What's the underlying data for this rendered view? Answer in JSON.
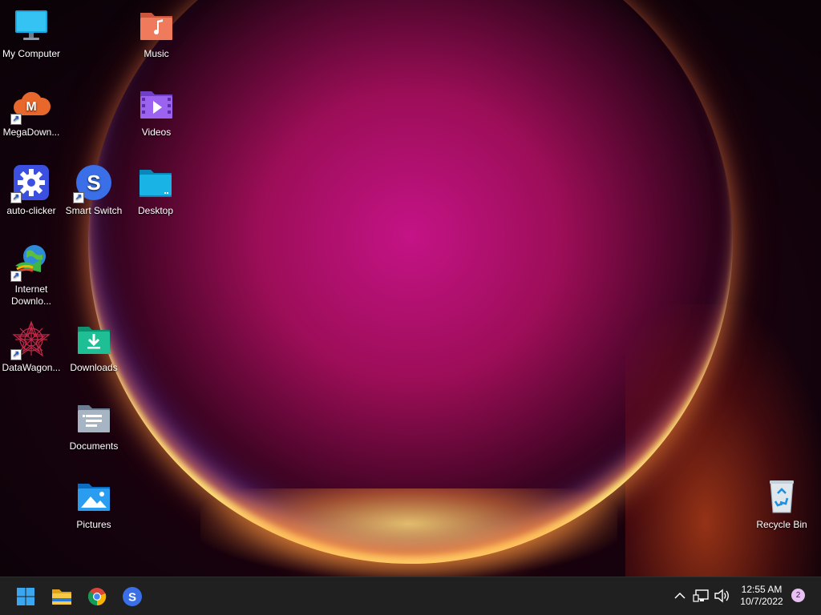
{
  "desktop_icons": {
    "my_computer": "My Computer",
    "music": "Music",
    "megadownloader": "MegaDown...",
    "videos": "Videos",
    "auto_clicker": "auto-clicker",
    "smart_switch": "Smart Switch",
    "desktop": "Desktop",
    "internet_download_line1": "Internet",
    "internet_download_line2": "Downlo...",
    "datawagon": "DataWagon...",
    "downloads": "Downloads",
    "documents": "Documents",
    "pictures": "Pictures",
    "recycle_bin": "Recycle Bin"
  },
  "taskbar": {
    "pinned": [
      "start-icon",
      "file-explorer-icon",
      "chrome-icon",
      "smart-switch-icon"
    ],
    "tray_icons": [
      "chevron-up-icon",
      "network-icon",
      "volume-icon"
    ],
    "time": "12:55 AM",
    "date": "10/7/2022",
    "notification_count": "2"
  },
  "colors": {
    "taskbar_bg": "#202020",
    "wallpaper_center": "#cd148c",
    "wallpaper_ring": "#ffd878"
  }
}
